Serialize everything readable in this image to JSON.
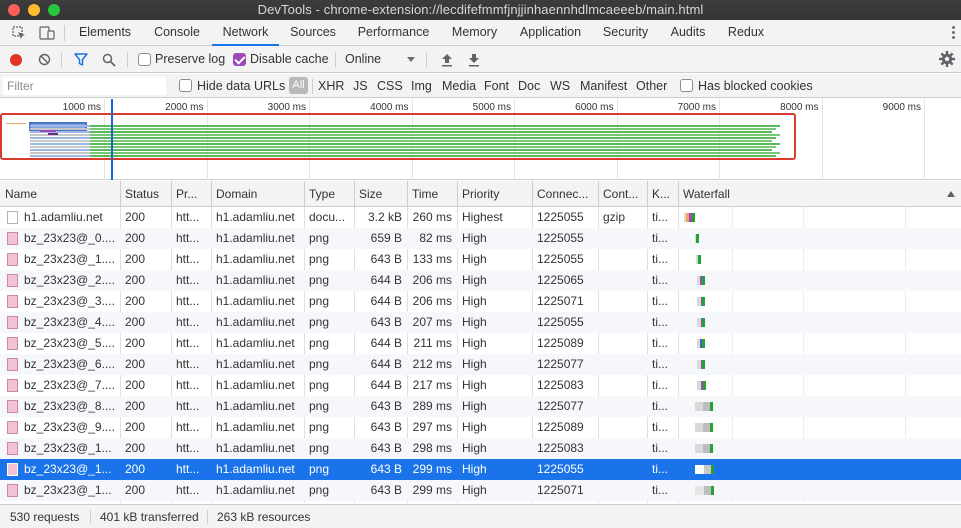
{
  "window": {
    "title": "DevTools - chrome-extension://lecdifefmmfjnjjinhaennhdlmcaeeeb/main.html"
  },
  "tabs": [
    "Elements",
    "Console",
    "Network",
    "Sources",
    "Performance",
    "Memory",
    "Application",
    "Security",
    "Audits",
    "Redux"
  ],
  "active_tab": "Network",
  "toolbar": {
    "preserve_log": "Preserve log",
    "preserve_log_checked": false,
    "disable_cache": "Disable cache",
    "disable_cache_checked": true,
    "throttle": "Online"
  },
  "filter": {
    "placeholder": "Filter",
    "hide_data_urls": "Hide data URLs",
    "all": "All",
    "types": [
      "XHR",
      "JS",
      "CSS",
      "Img",
      "Media",
      "Font",
      "Doc",
      "WS",
      "Manifest",
      "Other"
    ],
    "has_blocked_cookies": "Has blocked cookies"
  },
  "overview": {
    "ticks": [
      "1000 ms",
      "2000 ms",
      "3000 ms",
      "4000 ms",
      "5000 ms",
      "6000 ms",
      "7000 ms",
      "8000 ms",
      "9000 ms"
    ]
  },
  "columns": [
    "Name",
    "Status",
    "Pr...",
    "Domain",
    "Type",
    "Size",
    "Time",
    "Priority",
    "Connec...",
    "Cont...",
    "K...",
    "Waterfall"
  ],
  "rows": [
    {
      "name": "h1.adamliu.net",
      "status": "200",
      "protocol": "htt...",
      "domain": "h1.adamliu.net",
      "type": "docu...",
      "size": "3.2 kB",
      "time": "260 ms",
      "priority": "Highest",
      "connection": "1225055",
      "content": "gzip",
      "k": "ti...",
      "icon": "doc",
      "selected": false
    },
    {
      "name": "bz_23x23@_0....",
      "status": "200",
      "protocol": "htt...",
      "domain": "h1.adamliu.net",
      "type": "png",
      "size": "659 B",
      "time": "82 ms",
      "priority": "High",
      "connection": "1225055",
      "content": "",
      "k": "ti...",
      "icon": "img",
      "selected": false
    },
    {
      "name": "bz_23x23@_1....",
      "status": "200",
      "protocol": "htt...",
      "domain": "h1.adamliu.net",
      "type": "png",
      "size": "643 B",
      "time": "133 ms",
      "priority": "High",
      "connection": "1225055",
      "content": "",
      "k": "ti...",
      "icon": "img",
      "selected": false
    },
    {
      "name": "bz_23x23@_2....",
      "status": "200",
      "protocol": "htt...",
      "domain": "h1.adamliu.net",
      "type": "png",
      "size": "644 B",
      "time": "206 ms",
      "priority": "High",
      "connection": "1225065",
      "content": "",
      "k": "ti...",
      "icon": "img",
      "selected": false
    },
    {
      "name": "bz_23x23@_3....",
      "status": "200",
      "protocol": "htt...",
      "domain": "h1.adamliu.net",
      "type": "png",
      "size": "644 B",
      "time": "206 ms",
      "priority": "High",
      "connection": "1225071",
      "content": "",
      "k": "ti...",
      "icon": "img",
      "selected": false
    },
    {
      "name": "bz_23x23@_4....",
      "status": "200",
      "protocol": "htt...",
      "domain": "h1.adamliu.net",
      "type": "png",
      "size": "643 B",
      "time": "207 ms",
      "priority": "High",
      "connection": "1225055",
      "content": "",
      "k": "ti...",
      "icon": "img",
      "selected": false
    },
    {
      "name": "bz_23x23@_5....",
      "status": "200",
      "protocol": "htt...",
      "domain": "h1.adamliu.net",
      "type": "png",
      "size": "644 B",
      "time": "211 ms",
      "priority": "High",
      "connection": "1225089",
      "content": "",
      "k": "ti...",
      "icon": "img",
      "selected": false
    },
    {
      "name": "bz_23x23@_6....",
      "status": "200",
      "protocol": "htt...",
      "domain": "h1.adamliu.net",
      "type": "png",
      "size": "644 B",
      "time": "212 ms",
      "priority": "High",
      "connection": "1225077",
      "content": "",
      "k": "ti...",
      "icon": "img",
      "selected": false
    },
    {
      "name": "bz_23x23@_7....",
      "status": "200",
      "protocol": "htt...",
      "domain": "h1.adamliu.net",
      "type": "png",
      "size": "644 B",
      "time": "217 ms",
      "priority": "High",
      "connection": "1225083",
      "content": "",
      "k": "ti...",
      "icon": "img",
      "selected": false
    },
    {
      "name": "bz_23x23@_8....",
      "status": "200",
      "protocol": "htt...",
      "domain": "h1.adamliu.net",
      "type": "png",
      "size": "643 B",
      "time": "289 ms",
      "priority": "High",
      "connection": "1225077",
      "content": "",
      "k": "ti...",
      "icon": "img",
      "selected": false
    },
    {
      "name": "bz_23x23@_9....",
      "status": "200",
      "protocol": "htt...",
      "domain": "h1.adamliu.net",
      "type": "png",
      "size": "643 B",
      "time": "297 ms",
      "priority": "High",
      "connection": "1225089",
      "content": "",
      "k": "ti...",
      "icon": "img",
      "selected": false
    },
    {
      "name": "bz_23x23@_1...",
      "status": "200",
      "protocol": "htt...",
      "domain": "h1.adamliu.net",
      "type": "png",
      "size": "643 B",
      "time": "298 ms",
      "priority": "High",
      "connection": "1225083",
      "content": "",
      "k": "ti...",
      "icon": "img",
      "selected": false
    },
    {
      "name": "bz_23x23@_1...",
      "status": "200",
      "protocol": "htt...",
      "domain": "h1.adamliu.net",
      "type": "png",
      "size": "643 B",
      "time": "299 ms",
      "priority": "High",
      "connection": "1225055",
      "content": "",
      "k": "ti...",
      "icon": "img",
      "selected": true
    },
    {
      "name": "bz_23x23@_1...",
      "status": "200",
      "protocol": "htt...",
      "domain": "h1.adamliu.net",
      "type": "png",
      "size": "643 B",
      "time": "299 ms",
      "priority": "High",
      "connection": "1225071",
      "content": "",
      "k": "ti...",
      "icon": "img",
      "selected": false
    }
  ],
  "status_bar": {
    "requests": "530 requests",
    "transferred": "401 kB transferred",
    "resources": "263 kB resources"
  },
  "colors": {
    "accent": "#1a73e8",
    "record": "#e0362a",
    "checkbox": "#9c4ab6",
    "frame": "#d83a2e"
  }
}
